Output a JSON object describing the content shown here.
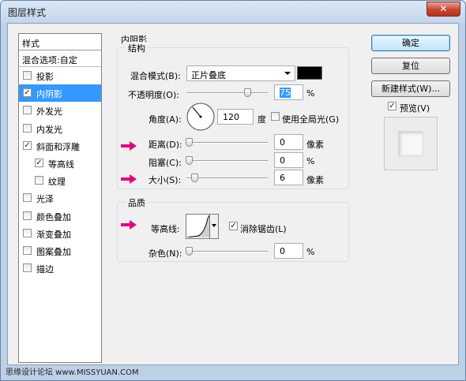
{
  "window": {
    "title": "图层样式",
    "close_glyph": "✕"
  },
  "style_list": {
    "header": "样式",
    "blend_options": "混合选项:自定",
    "items": [
      {
        "label": "投影",
        "checked": false,
        "sub": false,
        "selected": false
      },
      {
        "label": "内阴影",
        "checked": true,
        "sub": false,
        "selected": true
      },
      {
        "label": "外发光",
        "checked": false,
        "sub": false,
        "selected": false
      },
      {
        "label": "内发光",
        "checked": false,
        "sub": false,
        "selected": false
      },
      {
        "label": "斜面和浮雕",
        "checked": true,
        "sub": false,
        "selected": false
      },
      {
        "label": "等高线",
        "checked": true,
        "sub": true,
        "selected": false
      },
      {
        "label": "纹理",
        "checked": false,
        "sub": true,
        "selected": false
      },
      {
        "label": "光泽",
        "checked": false,
        "sub": false,
        "selected": false
      },
      {
        "label": "颜色叠加",
        "checked": false,
        "sub": false,
        "selected": false
      },
      {
        "label": "渐变叠加",
        "checked": false,
        "sub": false,
        "selected": false
      },
      {
        "label": "图案叠加",
        "checked": false,
        "sub": false,
        "selected": false
      },
      {
        "label": "描边",
        "checked": false,
        "sub": false,
        "selected": false
      }
    ]
  },
  "inner_shadow": {
    "section_title": "内阴影",
    "structure": {
      "title": "结构",
      "blend_mode_label": "混合模式(B):",
      "blend_mode_value": "正片叠底",
      "blend_color": "#000000",
      "opacity_label": "不透明度(O):",
      "opacity_value": "75",
      "opacity_unit": "%",
      "angle_label": "角度(A):",
      "angle_value": "120",
      "angle_unit": "度",
      "global_light_label": "使用全局光(G)",
      "global_light_checked": false,
      "distance_label": "距离(D):",
      "distance_value": "0",
      "distance_unit": "像素",
      "choke_label": "阻塞(C):",
      "choke_value": "0",
      "choke_unit": "%",
      "size_label": "大小(S):",
      "size_value": "6",
      "size_unit": "像素"
    },
    "quality": {
      "title": "品质",
      "contour_label": "等高线:",
      "anti_alias_label": "消除锯齿(L)",
      "anti_alias_checked": true,
      "noise_label": "杂色(N):",
      "noise_value": "0",
      "noise_unit": "%"
    }
  },
  "buttons": {
    "ok": "确定",
    "reset": "复位",
    "new_style": "新建样式(W)...",
    "preview_label": "预览(V)",
    "preview_checked": true
  },
  "watermark": "思缘设计论坛 www.MISSYUAN.COM",
  "colors": {
    "selection": "#3399ff",
    "annotation_arrow": "#e6007e"
  }
}
